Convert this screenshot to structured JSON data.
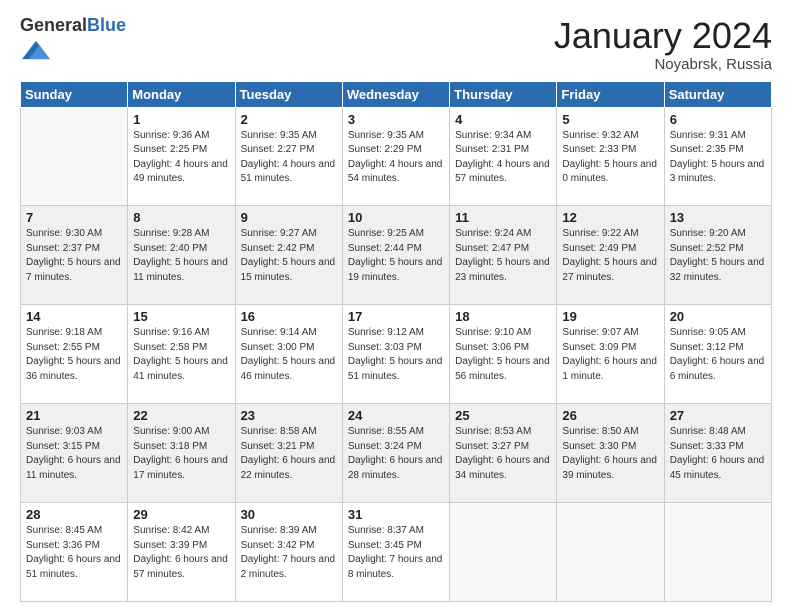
{
  "header": {
    "logo_general": "General",
    "logo_blue": "Blue",
    "month": "January 2024",
    "location": "Noyabrsk, Russia"
  },
  "weekdays": [
    "Sunday",
    "Monday",
    "Tuesday",
    "Wednesday",
    "Thursday",
    "Friday",
    "Saturday"
  ],
  "weeks": [
    [
      {
        "day": "",
        "sunrise": "",
        "sunset": "",
        "daylight": ""
      },
      {
        "day": "1",
        "sunrise": "Sunrise: 9:36 AM",
        "sunset": "Sunset: 2:25 PM",
        "daylight": "Daylight: 4 hours and 49 minutes."
      },
      {
        "day": "2",
        "sunrise": "Sunrise: 9:35 AM",
        "sunset": "Sunset: 2:27 PM",
        "daylight": "Daylight: 4 hours and 51 minutes."
      },
      {
        "day": "3",
        "sunrise": "Sunrise: 9:35 AM",
        "sunset": "Sunset: 2:29 PM",
        "daylight": "Daylight: 4 hours and 54 minutes."
      },
      {
        "day": "4",
        "sunrise": "Sunrise: 9:34 AM",
        "sunset": "Sunset: 2:31 PM",
        "daylight": "Daylight: 4 hours and 57 minutes."
      },
      {
        "day": "5",
        "sunrise": "Sunrise: 9:32 AM",
        "sunset": "Sunset: 2:33 PM",
        "daylight": "Daylight: 5 hours and 0 minutes."
      },
      {
        "day": "6",
        "sunrise": "Sunrise: 9:31 AM",
        "sunset": "Sunset: 2:35 PM",
        "daylight": "Daylight: 5 hours and 3 minutes."
      }
    ],
    [
      {
        "day": "7",
        "sunrise": "Sunrise: 9:30 AM",
        "sunset": "Sunset: 2:37 PM",
        "daylight": "Daylight: 5 hours and 7 minutes."
      },
      {
        "day": "8",
        "sunrise": "Sunrise: 9:28 AM",
        "sunset": "Sunset: 2:40 PM",
        "daylight": "Daylight: 5 hours and 11 minutes."
      },
      {
        "day": "9",
        "sunrise": "Sunrise: 9:27 AM",
        "sunset": "Sunset: 2:42 PM",
        "daylight": "Daylight: 5 hours and 15 minutes."
      },
      {
        "day": "10",
        "sunrise": "Sunrise: 9:25 AM",
        "sunset": "Sunset: 2:44 PM",
        "daylight": "Daylight: 5 hours and 19 minutes."
      },
      {
        "day": "11",
        "sunrise": "Sunrise: 9:24 AM",
        "sunset": "Sunset: 2:47 PM",
        "daylight": "Daylight: 5 hours and 23 minutes."
      },
      {
        "day": "12",
        "sunrise": "Sunrise: 9:22 AM",
        "sunset": "Sunset: 2:49 PM",
        "daylight": "Daylight: 5 hours and 27 minutes."
      },
      {
        "day": "13",
        "sunrise": "Sunrise: 9:20 AM",
        "sunset": "Sunset: 2:52 PM",
        "daylight": "Daylight: 5 hours and 32 minutes."
      }
    ],
    [
      {
        "day": "14",
        "sunrise": "Sunrise: 9:18 AM",
        "sunset": "Sunset: 2:55 PM",
        "daylight": "Daylight: 5 hours and 36 minutes."
      },
      {
        "day": "15",
        "sunrise": "Sunrise: 9:16 AM",
        "sunset": "Sunset: 2:58 PM",
        "daylight": "Daylight: 5 hours and 41 minutes."
      },
      {
        "day": "16",
        "sunrise": "Sunrise: 9:14 AM",
        "sunset": "Sunset: 3:00 PM",
        "daylight": "Daylight: 5 hours and 46 minutes."
      },
      {
        "day": "17",
        "sunrise": "Sunrise: 9:12 AM",
        "sunset": "Sunset: 3:03 PM",
        "daylight": "Daylight: 5 hours and 51 minutes."
      },
      {
        "day": "18",
        "sunrise": "Sunrise: 9:10 AM",
        "sunset": "Sunset: 3:06 PM",
        "daylight": "Daylight: 5 hours and 56 minutes."
      },
      {
        "day": "19",
        "sunrise": "Sunrise: 9:07 AM",
        "sunset": "Sunset: 3:09 PM",
        "daylight": "Daylight: 6 hours and 1 minute."
      },
      {
        "day": "20",
        "sunrise": "Sunrise: 9:05 AM",
        "sunset": "Sunset: 3:12 PM",
        "daylight": "Daylight: 6 hours and 6 minutes."
      }
    ],
    [
      {
        "day": "21",
        "sunrise": "Sunrise: 9:03 AM",
        "sunset": "Sunset: 3:15 PM",
        "daylight": "Daylight: 6 hours and 11 minutes."
      },
      {
        "day": "22",
        "sunrise": "Sunrise: 9:00 AM",
        "sunset": "Sunset: 3:18 PM",
        "daylight": "Daylight: 6 hours and 17 minutes."
      },
      {
        "day": "23",
        "sunrise": "Sunrise: 8:58 AM",
        "sunset": "Sunset: 3:21 PM",
        "daylight": "Daylight: 6 hours and 22 minutes."
      },
      {
        "day": "24",
        "sunrise": "Sunrise: 8:55 AM",
        "sunset": "Sunset: 3:24 PM",
        "daylight": "Daylight: 6 hours and 28 minutes."
      },
      {
        "day": "25",
        "sunrise": "Sunrise: 8:53 AM",
        "sunset": "Sunset: 3:27 PM",
        "daylight": "Daylight: 6 hours and 34 minutes."
      },
      {
        "day": "26",
        "sunrise": "Sunrise: 8:50 AM",
        "sunset": "Sunset: 3:30 PM",
        "daylight": "Daylight: 6 hours and 39 minutes."
      },
      {
        "day": "27",
        "sunrise": "Sunrise: 8:48 AM",
        "sunset": "Sunset: 3:33 PM",
        "daylight": "Daylight: 6 hours and 45 minutes."
      }
    ],
    [
      {
        "day": "28",
        "sunrise": "Sunrise: 8:45 AM",
        "sunset": "Sunset: 3:36 PM",
        "daylight": "Daylight: 6 hours and 51 minutes."
      },
      {
        "day": "29",
        "sunrise": "Sunrise: 8:42 AM",
        "sunset": "Sunset: 3:39 PM",
        "daylight": "Daylight: 6 hours and 57 minutes."
      },
      {
        "day": "30",
        "sunrise": "Sunrise: 8:39 AM",
        "sunset": "Sunset: 3:42 PM",
        "daylight": "Daylight: 7 hours and 2 minutes."
      },
      {
        "day": "31",
        "sunrise": "Sunrise: 8:37 AM",
        "sunset": "Sunset: 3:45 PM",
        "daylight": "Daylight: 7 hours and 8 minutes."
      },
      {
        "day": "",
        "sunrise": "",
        "sunset": "",
        "daylight": ""
      },
      {
        "day": "",
        "sunrise": "",
        "sunset": "",
        "daylight": ""
      },
      {
        "day": "",
        "sunrise": "",
        "sunset": "",
        "daylight": ""
      }
    ]
  ]
}
